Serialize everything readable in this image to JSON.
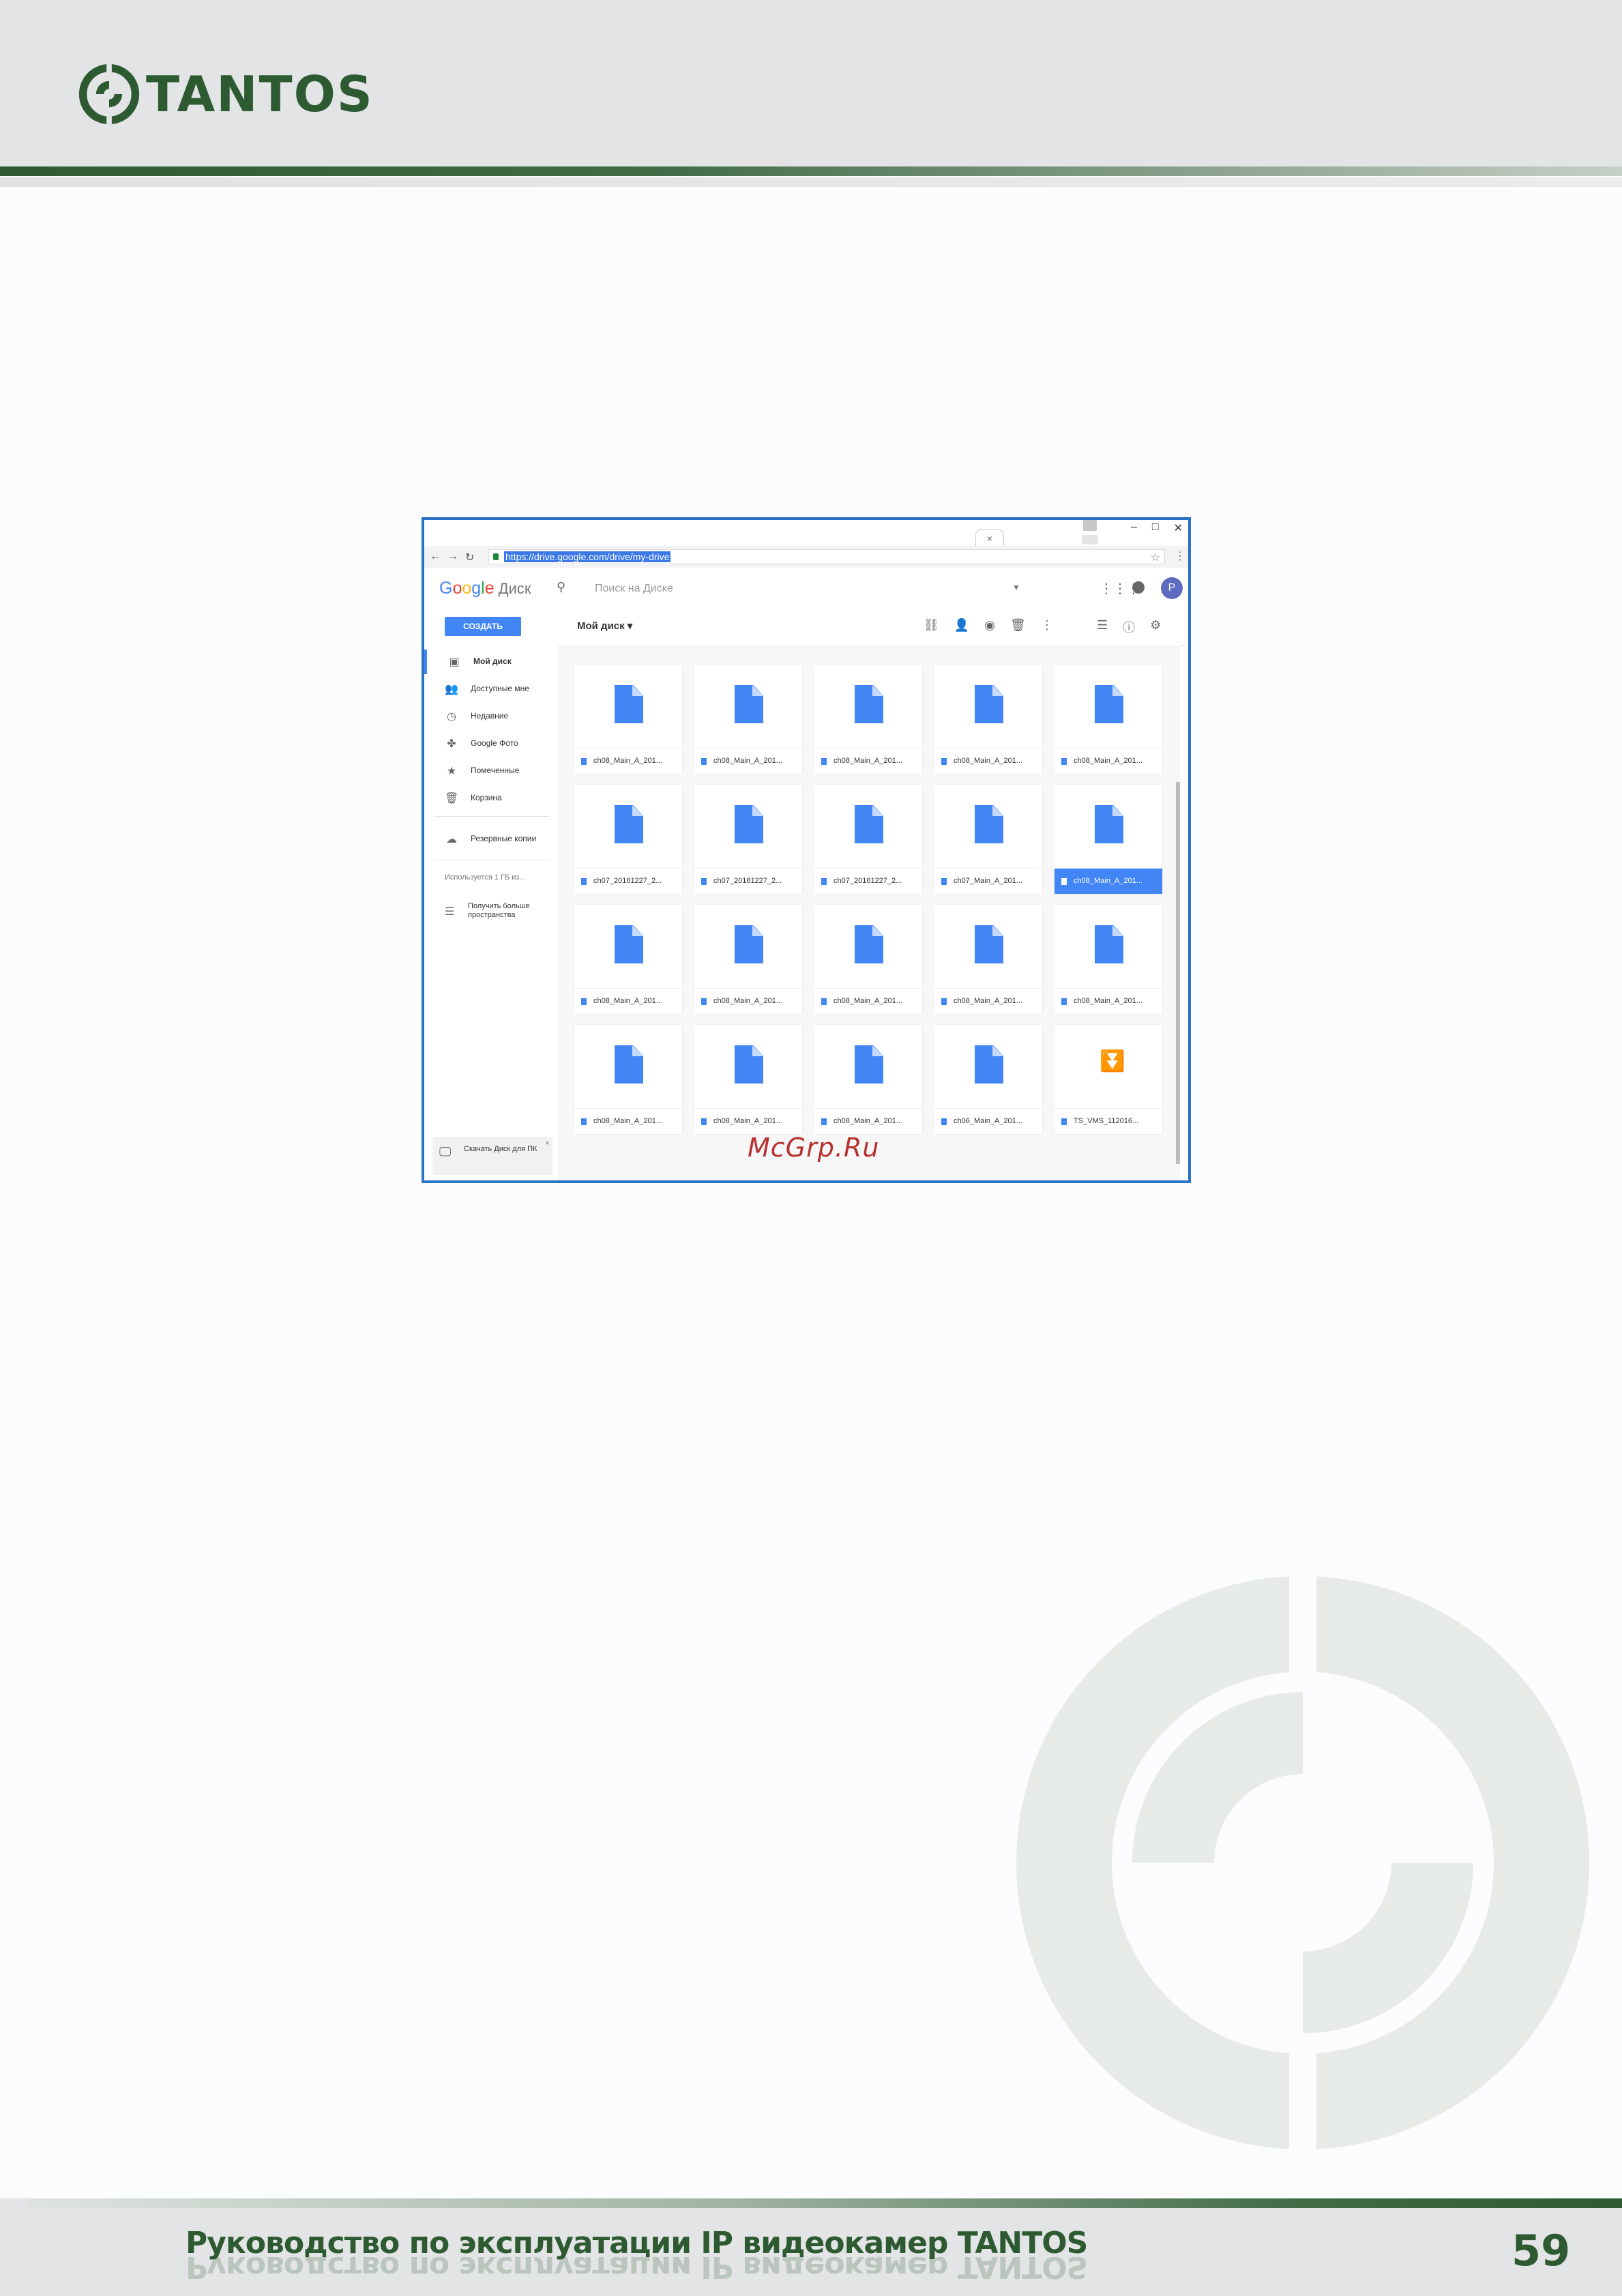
{
  "header": {
    "brand": "TANTOS"
  },
  "footer": {
    "title": "Руководство по эксплуатации IP видеокамер TANTOS",
    "page_number": "59"
  },
  "watermark": "McGrp.Ru",
  "browser": {
    "url": "https://drive.google.com/drive/my-drive",
    "tab_close": "×",
    "app": {
      "logo": "Google",
      "product": "Диск",
      "search_placeholder": "Поиск на Диске",
      "avatar_letter": "P",
      "create_label": "СОЗДАТЬ",
      "location_label": "Мой диск",
      "sidebar": {
        "items": [
          {
            "label": "Мой диск",
            "icon": "drive-icon",
            "active": true
          },
          {
            "label": "Доступные мне",
            "icon": "people-icon"
          },
          {
            "label": "Недавние",
            "icon": "clock-icon"
          },
          {
            "label": "Google Фото",
            "icon": "pinwheel-icon"
          },
          {
            "label": "Помеченные",
            "icon": "star-icon"
          },
          {
            "label": "Корзина",
            "icon": "trash-icon"
          }
        ],
        "backups": "Резервные копии",
        "storage": "Используется 1 ГБ из...",
        "more_space": "Получить больше пространства",
        "download_box": "Скачать Диск для ПК"
      },
      "files": [
        [
          "ch08_Main_A_201...",
          "ch08_Main_A_201...",
          "ch08_Main_A_201...",
          "ch08_Main_A_201...",
          "ch08_Main_A_201..."
        ],
        [
          "ch07_20161227_2...",
          "ch07_20161227_2...",
          "ch07_20161227_2...",
          "ch07_Main_A_201...",
          "ch08_Main_A_201..."
        ],
        [
          "ch08_Main_A_201...",
          "ch08_Main_A_201...",
          "ch08_Main_A_201...",
          "ch08_Main_A_201...",
          "ch08_Main_A_201..."
        ],
        [
          "ch08_Main_A_201...",
          "ch08_Main_A_201...",
          "ch08_Main_A_201...",
          "ch06_Main_A_201...",
          "TS_VMS_112016..."
        ]
      ],
      "selected_file": {
        "row": 2,
        "col": 5
      }
    }
  },
  "colors": {
    "brand_green": "#2e5a32",
    "drive_blue": "#4285f4",
    "frame_blue": "#2a72c3"
  }
}
